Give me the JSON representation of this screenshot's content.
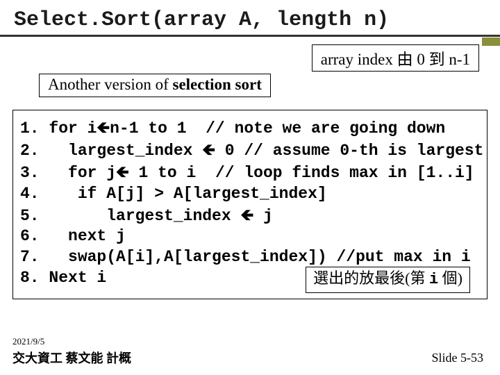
{
  "title": "Select.Sort(array A, length n)",
  "index_note": "array index 由 0 到 n-1",
  "subtitle_prefix": "Another version of ",
  "subtitle_bold": "selection sort",
  "code": {
    "l1": "1. for i",
    "l1b": "n-1 to 1  // note we are going down",
    "l2": "2.   largest_index ",
    "l2b": " 0 // assume 0-th is largest",
    "l3": "3.   for j",
    "l3b": " 1 to i  // loop finds max in [1..i]",
    "l4": "4.    if A[j] > A[largest_index]",
    "l5": "5.       largest_index ",
    "l5b": " j",
    "l6": "6.   next j",
    "l7": "7.   swap(A[i],A[largest_index]) //put max in i",
    "l8": "8. Next i"
  },
  "inner_note_pre": "選出的放最後(第 ",
  "inner_note_mono": "i",
  "inner_note_post": " 個)",
  "date": "2021/9/5",
  "footer_left": "交大資工 蔡文能 計概",
  "footer_right": "Slide 5-53",
  "arrow": "🡸"
}
